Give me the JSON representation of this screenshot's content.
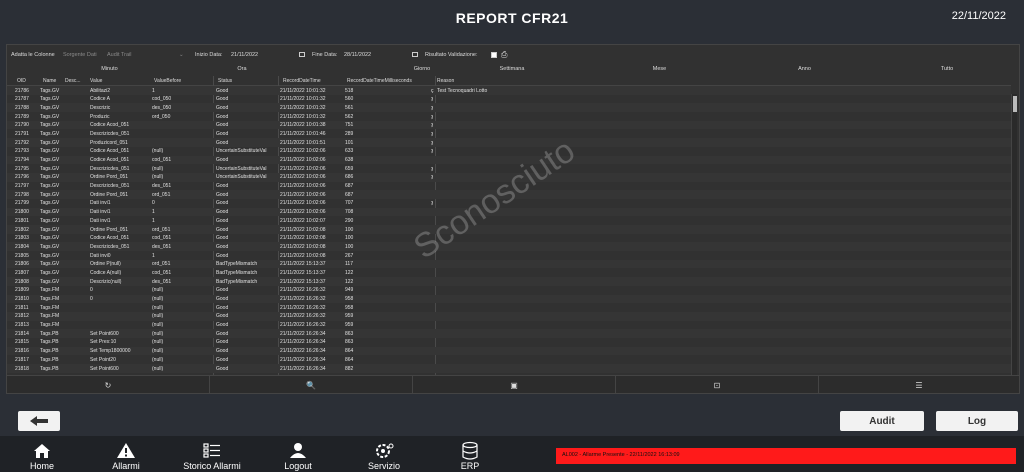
{
  "header": {
    "title": "REPORT CFR21",
    "date": "22/11/2022"
  },
  "filters": {
    "adatta_colonne": "Adatta le Colonne",
    "sorgente": "Sorgente Dati",
    "sorgente_value": "Audit Trail",
    "inizio_label": "Inizio Data:",
    "inizio_value": "21/11/2022",
    "fine_label": "Fine Data:",
    "fine_value": "28/11/2022",
    "risultato_label": "Risultato Validazione:"
  },
  "groups": [
    "Minuto",
    "Ora",
    "Giorno",
    "Settimana",
    "Mese",
    "Anno",
    "Tutto"
  ],
  "columns": [
    "OID",
    "Name",
    "Desc...",
    "Value",
    "ValueBefore",
    "Status",
    "RecordDateTime",
    "RecordDateTimeMilliseconds",
    "Reason"
  ],
  "rows": [
    {
      "oid": "21786",
      "name": "Tags.GV",
      "val": "Abilitazi2",
      "vb": "1",
      "st": "Good",
      "dt": "21/11/2022 10:01:32",
      "ms": "518",
      "mk": "ç",
      "rs": "Test Tecnoquadri Lotto"
    },
    {
      "oid": "21787",
      "name": "Tags.GV",
      "val": "Codice A",
      "vb": "cod_050",
      "st": "Good",
      "dt": "21/11/2022 10:01:32",
      "ms": "560",
      "mk": "ȝ",
      "rs": ""
    },
    {
      "oid": "21788",
      "name": "Tags.GV",
      "val": "Descrizic",
      "vb": "des_050",
      "st": "Good",
      "dt": "21/11/2022 10:01:32",
      "ms": "561",
      "mk": "ȝ",
      "rs": ""
    },
    {
      "oid": "21789",
      "name": "Tags.GV",
      "val": "Produzic",
      "vb": "ord_050",
      "st": "Good",
      "dt": "21/11/2022 10:01:32",
      "ms": "562",
      "mk": "ȝ",
      "rs": ""
    },
    {
      "oid": "21790",
      "name": "Tags.GV",
      "val": "Codice Acod_051",
      "vb": "",
      "st": "Good",
      "dt": "21/11/2022 10:01:38",
      "ms": "751",
      "mk": "ȝ",
      "rs": ""
    },
    {
      "oid": "21791",
      "name": "Tags.GV",
      "val": "Descrizicdes_051",
      "vb": "",
      "st": "Good",
      "dt": "21/11/2022 10:01:46",
      "ms": "289",
      "mk": "ȝ",
      "rs": ""
    },
    {
      "oid": "21792",
      "name": "Tags.GV",
      "val": "Produzicord_051",
      "vb": "",
      "st": "Good",
      "dt": "21/11/2022 10:01:51",
      "ms": "101",
      "mk": "ȝ",
      "rs": ""
    },
    {
      "oid": "21793",
      "name": "Tags.GV",
      "val": "Codice Acod_051",
      "vb": "(null)",
      "st": "UncertainSubstituteVal",
      "dt": "21/11/2022 10:02:06",
      "ms": "633",
      "mk": "ȝ",
      "rs": ""
    },
    {
      "oid": "21794",
      "name": "Tags.GV",
      "val": "Codice Acod_051",
      "vb": "cod_051",
      "st": "Good",
      "dt": "21/11/2022 10:02:06",
      "ms": "638",
      "mk": "",
      "rs": ""
    },
    {
      "oid": "21795",
      "name": "Tags.GV",
      "val": "Descrizicdes_051",
      "vb": "(null)",
      "st": "UncertainSubstituteVal",
      "dt": "21/11/2022 10:02:06",
      "ms": "659",
      "mk": "ȝ",
      "rs": ""
    },
    {
      "oid": "21796",
      "name": "Tags.GV",
      "val": "Ordine Pord_051",
      "vb": "(null)",
      "st": "UncertainSubstituteVal",
      "dt": "21/11/2022 10:02:06",
      "ms": "686",
      "mk": "ȝ",
      "rs": ""
    },
    {
      "oid": "21797",
      "name": "Tags.GV",
      "val": "Descrizicdes_051",
      "vb": "des_051",
      "st": "Good",
      "dt": "21/11/2022 10:02:06",
      "ms": "687",
      "mk": "",
      "rs": ""
    },
    {
      "oid": "21798",
      "name": "Tags.GV",
      "val": "Ordine Pord_051",
      "vb": "ord_051",
      "st": "Good",
      "dt": "21/11/2022 10:02:06",
      "ms": "687",
      "mk": "",
      "rs": ""
    },
    {
      "oid": "21799",
      "name": "Tags.GV",
      "val": "Dati invi1",
      "vb": "0",
      "st": "Good",
      "dt": "21/11/2022 10:02:06",
      "ms": "707",
      "mk": "ȝ",
      "rs": ""
    },
    {
      "oid": "21800",
      "name": "Tags.GV",
      "val": "Dati invi1",
      "vb": "1",
      "st": "Good",
      "dt": "21/11/2022 10:02:06",
      "ms": "708",
      "mk": "",
      "rs": ""
    },
    {
      "oid": "21801",
      "name": "Tags.GV",
      "val": "Dati invi1",
      "vb": "1",
      "st": "Good",
      "dt": "21/11/2022 10:02:07",
      "ms": "290",
      "mk": "",
      "rs": ""
    },
    {
      "oid": "21802",
      "name": "Tags.GV",
      "val": "Ordine Pord_051",
      "vb": "ord_051",
      "st": "Good",
      "dt": "21/11/2022 10:02:08",
      "ms": "100",
      "mk": "",
      "rs": ""
    },
    {
      "oid": "21803",
      "name": "Tags.GV",
      "val": "Codice Acod_051",
      "vb": "cod_051",
      "st": "Good",
      "dt": "21/11/2022 10:02:08",
      "ms": "100",
      "mk": "",
      "rs": ""
    },
    {
      "oid": "21804",
      "name": "Tags.GV",
      "val": "Descrizicdes_051",
      "vb": "des_051",
      "st": "Good",
      "dt": "21/11/2022 10:02:08",
      "ms": "100",
      "mk": "",
      "rs": ""
    },
    {
      "oid": "21805",
      "name": "Tags.GV",
      "val": "Dati invi0",
      "vb": "1",
      "st": "Good",
      "dt": "21/11/2022 10:02:08",
      "ms": "267",
      "mk": "",
      "rs": ""
    },
    {
      "oid": "21806",
      "name": "Tags.GV",
      "val": "Ordine P(null)",
      "vb": "ord_051",
      "st": "BadTypeMismatch",
      "dt": "21/11/2022 15:13:37",
      "ms": "117",
      "mk": "",
      "rs": ""
    },
    {
      "oid": "21807",
      "name": "Tags.GV",
      "val": "Codice A(null)",
      "vb": "cod_051",
      "st": "BadTypeMismatch",
      "dt": "21/11/2022 15:13:37",
      "ms": "122",
      "mk": "",
      "rs": ""
    },
    {
      "oid": "21808",
      "name": "Tags.GV",
      "val": "Descrizic(null)",
      "vb": "des_051",
      "st": "BadTypeMismatch",
      "dt": "21/11/2022 15:13:37",
      "ms": "122",
      "mk": "",
      "rs": ""
    },
    {
      "oid": "21809",
      "name": "Tags.FM",
      "val": "0",
      "vb": "(null)",
      "st": "Good",
      "dt": "21/11/2022 16:26:32",
      "ms": "949",
      "mk": "",
      "rs": ""
    },
    {
      "oid": "21810",
      "name": "Tags.FM",
      "val": "0",
      "vb": "(null)",
      "st": "Good",
      "dt": "21/11/2022 16:26:32",
      "ms": "958",
      "mk": "",
      "rs": ""
    },
    {
      "oid": "21811",
      "name": "Tags.FM",
      "val": "",
      "vb": "(null)",
      "st": "Good",
      "dt": "21/11/2022 16:26:32",
      "ms": "958",
      "mk": "",
      "rs": ""
    },
    {
      "oid": "21812",
      "name": "Tags.FM",
      "val": "",
      "vb": "(null)",
      "st": "Good",
      "dt": "21/11/2022 16:26:32",
      "ms": "959",
      "mk": "",
      "rs": ""
    },
    {
      "oid": "21813",
      "name": "Tags.FM",
      "val": "",
      "vb": "(null)",
      "st": "Good",
      "dt": "21/11/2022 16:26:32",
      "ms": "959",
      "mk": "",
      "rs": ""
    },
    {
      "oid": "21814",
      "name": "Tags.PB",
      "val": "Set Point600",
      "vb": "(null)",
      "st": "Good",
      "dt": "21/11/2022 16:26:34",
      "ms": "863",
      "mk": "",
      "rs": ""
    },
    {
      "oid": "21815",
      "name": "Tags.PB",
      "val": "Set Pres:10",
      "vb": "(null)",
      "st": "Good",
      "dt": "21/11/2022 16:26:34",
      "ms": "863",
      "mk": "",
      "rs": ""
    },
    {
      "oid": "21816",
      "name": "Tags.PB",
      "val": "Set Temp1800000",
      "vb": "(null)",
      "st": "Good",
      "dt": "21/11/2022 16:26:34",
      "ms": "864",
      "mk": "",
      "rs": ""
    },
    {
      "oid": "21817",
      "name": "Tags.PB",
      "val": "Set Point20",
      "vb": "(null)",
      "st": "Good",
      "dt": "21/11/2022 16:26:34",
      "ms": "864",
      "mk": "",
      "rs": ""
    },
    {
      "oid": "21818",
      "name": "Tags.PB",
      "val": "Set Point600",
      "vb": "(null)",
      "st": "Good",
      "dt": "21/11/2022 16:26:34",
      "ms": "882",
      "mk": "",
      "rs": ""
    }
  ],
  "watermark": "Sconosciuto",
  "buttons": {
    "audit": "Audit",
    "log": "Log"
  },
  "nav": [
    "Home",
    "Allarmi",
    "Storico Allarmi",
    "Logout",
    "Servizio",
    "ERP"
  ],
  "alarm_text": "AL002 - Allarme Presente - 22/11/2022 16:13:09",
  "colors": {
    "background": "#2b2f36",
    "alarm": "#ff1a1a"
  }
}
